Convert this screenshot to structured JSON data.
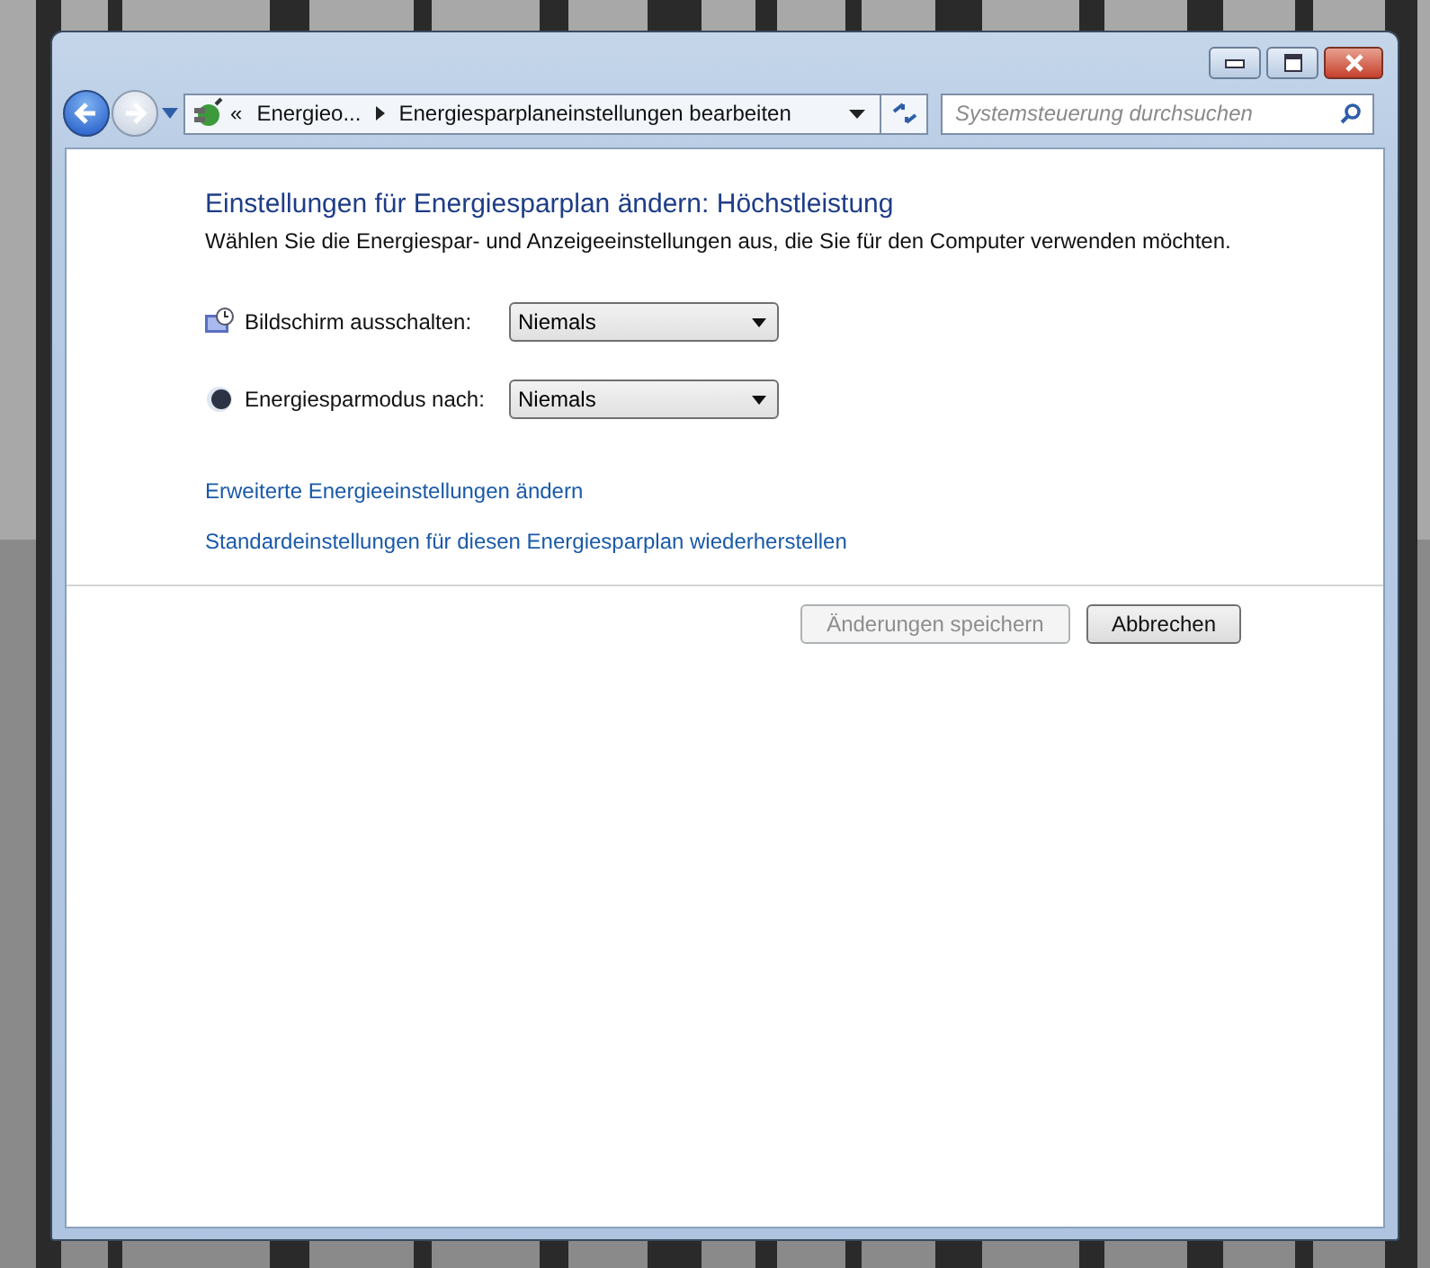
{
  "navigation": [
    {
      "kind": "back",
      "disabled": false
    },
    {
      "kind": "forward",
      "disabled": true
    }
  ],
  "address_bar": {
    "overflow_marker": "«",
    "breadcrumbs": [
      "Energieo...",
      "Energiesparplaneinstellungen bearbeiten"
    ]
  },
  "search": {
    "placeholder": "Systemsteuerung durchsuchen"
  },
  "title": "Einstellungen für Energiesparplan ändern: Höchstleistung",
  "description": "Wählen Sie die Energiespar- und Anzeigeeinstellungen aus, die Sie für den Computer verwenden möchten.",
  "settings": [
    {
      "kind": "display",
      "label": "Bildschirm ausschalten:",
      "value": "Niemals"
    },
    {
      "kind": "sleep",
      "label": "Energiesparmodus nach:",
      "value": "Niemals"
    }
  ],
  "links": [
    "Erweiterte Energieeinstellungen ändern",
    "Standardeinstellungen für diesen Energiesparplan wiederherstellen"
  ],
  "buttons": [
    {
      "label": "Änderungen speichern",
      "disabled": true
    },
    {
      "label": "Abbrechen",
      "disabled": false
    }
  ]
}
